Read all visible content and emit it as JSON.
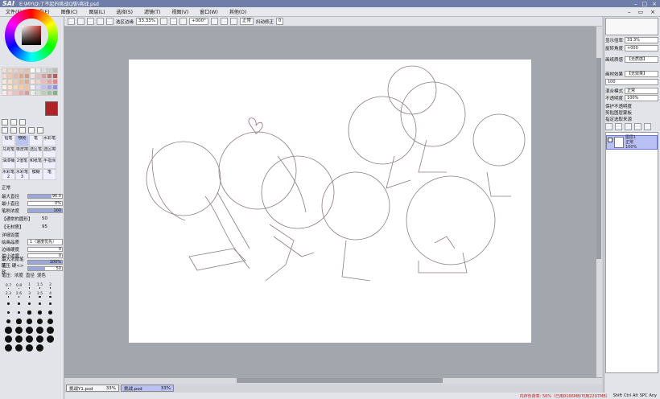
{
  "app": {
    "logo": "SAI",
    "title": "E:\\MY\\Q\\了不起的挑战Q版\\挑战.psd",
    "window_controls": [
      "–",
      "□",
      "×"
    ]
  },
  "menu": {
    "items": [
      "文件(F)",
      "编辑(E)",
      "图像(C)",
      "图层(L)",
      "选择(S)",
      "滤镜(T)",
      "视图(V)",
      "窗口(W)",
      "其他(O)"
    ],
    "doc_controls": [
      "–",
      "▭",
      "×"
    ]
  },
  "toolbar": {
    "select_edge_label": "选区边缘",
    "zoom": "33.33%",
    "rotation": "+000°",
    "mode": "正常",
    "stabilizer_label": "抖动修正",
    "stabilizer_value": "0"
  },
  "leftpanel": {
    "swatch_colors": [
      "#f4e0d0",
      "#f0d8c8",
      "#ead0c0",
      "#e8c8b8",
      "#e0c0a8",
      "#fff",
      "#eee",
      "#ddd",
      "#ccc",
      "#bbb",
      "#f8d8c8",
      "#f0c8b0",
      "#e8b8a0",
      "#e0a890",
      "#d89880",
      "#f0e0e0",
      "#e0c0c0",
      "#d0a0a0",
      "#c08080",
      "#b06060",
      "#f8e8d8",
      "#f4dcc8",
      "#ecccb4",
      "#e4bca0",
      "#dcac8c",
      "#fce4e4",
      "#f8d0d0",
      "#f0b8b8",
      "#e8a0a0",
      "#e08888",
      "#fff0e0",
      "#ffe4cc",
      "#ffd8b8",
      "#ffcca4",
      "#ffc090",
      "#f0f0ff",
      "#d8d8f8",
      "#c0c0f0",
      "#a8a8e8",
      "#9090e0",
      "#ffe8e8",
      "#f8d4d4",
      "#f0c0c0",
      "#e8acac",
      "#e09898",
      "#e8f0e8",
      "#d0e0d0",
      "#b8d0b8",
      "#a0c0a0",
      "#88b088"
    ],
    "brushes": [
      "铅笔",
      "喷枪",
      "笔",
      "水彩笔",
      "马克笔",
      "橡皮擦",
      "选区笔",
      "选区擦",
      "油漆桶",
      "2值笔",
      "和纸笔",
      "手指涂",
      "水彩笔2",
      "水彩笔3",
      "模糊",
      "笔"
    ],
    "blend_mode": "正常",
    "size_label": "最大直径",
    "size_mult": "x 1.0",
    "size_value": "96.0",
    "min_size_label": "最小直径",
    "min_size_value": "0%",
    "density_label": "笔刷浓度",
    "density_value": "100",
    "shape_label": "【通常的圆形】",
    "shape_value": "50",
    "texture_label": "【无材质】",
    "texture_value": "95",
    "detail_label": "详细设置",
    "quality_label": "绘画品质",
    "quality_value": "1（速度优先）",
    "edge_hard_label": "边缘硬度",
    "edge_hard_value": "0",
    "min_density_label": "最小浓度",
    "min_density_value": "0",
    "max_pressure_label": "最大浓度笔压",
    "max_pressure_value": "100%",
    "pressure_label": "笔压 硬<>软",
    "pressure_value": "50",
    "pressure_opts": [
      "笔压:",
      "浓度",
      "直径",
      "混色"
    ],
    "dot_sizes": [
      "0.7",
      "0.8",
      "1",
      "1.5",
      "2",
      "2.3",
      "2.6",
      "3",
      "3.5",
      "4",
      "5",
      "6",
      "7",
      "8",
      "9",
      "10",
      "12",
      "14",
      "16",
      "20",
      "25",
      "30",
      "35",
      "40",
      "50",
      "60",
      "70",
      "80",
      "100",
      "120",
      "150",
      "170",
      "200",
      "250",
      "300",
      "350",
      "400",
      "450",
      "500"
    ]
  },
  "tabs": [
    {
      "name": "挑战Y1.psd",
      "zoom": "33%",
      "active": false
    },
    {
      "name": "挑战.psd",
      "zoom": "33%",
      "active": true
    }
  ],
  "status": {
    "memory": "内存负荷率: 56%（已用0166MB/可用2297MB）",
    "keys": [
      "Shift",
      "Ctrl",
      "Alt",
      "SPC",
      "Any"
    ]
  },
  "rightpanel": {
    "zoom_label": "显示倍率",
    "zoom_value": "33.3%",
    "angle_label": "旋转角度",
    "angle_value": "+000",
    "paper_label": "画纸质感",
    "paper_value": "【无质感】",
    "effect_label": "画材效果",
    "effect_value": "【无效果】",
    "effect_strength": "100",
    "blend_label": "混合模式",
    "blend_value": "正常",
    "opacity_label": "不透明度",
    "opacity_value": "100%",
    "protect_label": "保护不透明度",
    "clip_label": "剪贴图层蒙板",
    "selsrc_label": "指定选取来源",
    "layer_name": "图层1",
    "layer_mode": "正常",
    "layer_opacity": "100%"
  }
}
